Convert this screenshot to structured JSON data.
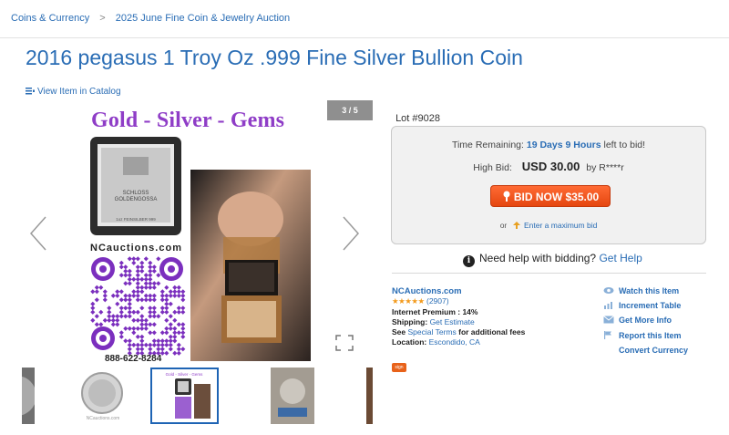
{
  "breadcrumb": {
    "items": [
      "Coins & Currency",
      "2025 June Fine Coin & Jewelry Auction"
    ],
    "separator": ">"
  },
  "title": "2016 pegasus 1 Troy Oz .999 Fine Silver Bullion Coin",
  "catalog_link": "View Item in Catalog",
  "viewer": {
    "counter": "3 / 5",
    "banner": "Gold - Silver - Gems",
    "site_label": "NCauctions.com",
    "phone": "888-622-8284",
    "bar_text_1": "SCHLOSS",
    "bar_text_2": "GOLDENGOSSA",
    "bar_text_3": "1oz FEINSILBER 999",
    "thumb_sel_label": "Gold - Silver - Gems",
    "thumb_coin_label": "NCauctions.com"
  },
  "lot": {
    "label": "Lot #9028"
  },
  "bidding": {
    "time_label": "Time Remaining:",
    "time_value": "19 Days 9 Hours",
    "time_suffix": "left to bid!",
    "high_bid_label": "High Bid:",
    "high_bid_amount": "USD 30.00",
    "high_bid_by": "by R****r",
    "bid_button": "BID NOW $35.00",
    "or_text": "or",
    "max_bid_link": "Enter a maximum bid"
  },
  "help": {
    "text": "Need help with bidding?",
    "link": "Get Help"
  },
  "seller": {
    "name": "NCAuctions.com",
    "stars": "★★★★★",
    "rating_count": "(2907)",
    "premium_label": "Internet Premium : 14%",
    "shipping_label": "Shipping:",
    "shipping_link": "Get Estimate",
    "terms_prefix": "See",
    "terms_link": "Special Terms",
    "terms_suffix": "for additional fees",
    "location_label": "Location:",
    "location_value": "Escondido, CA",
    "badge": "sign"
  },
  "actions": {
    "watch": "Watch this Item",
    "increment": "Increment Table",
    "info": "Get More Info",
    "report": "Report this Item",
    "currency": "Convert Currency"
  },
  "colors": {
    "link": "#2a6db5",
    "bid_button": "#e54710",
    "stars": "#f39a1c",
    "qr_purple": "#7b2fbe"
  }
}
